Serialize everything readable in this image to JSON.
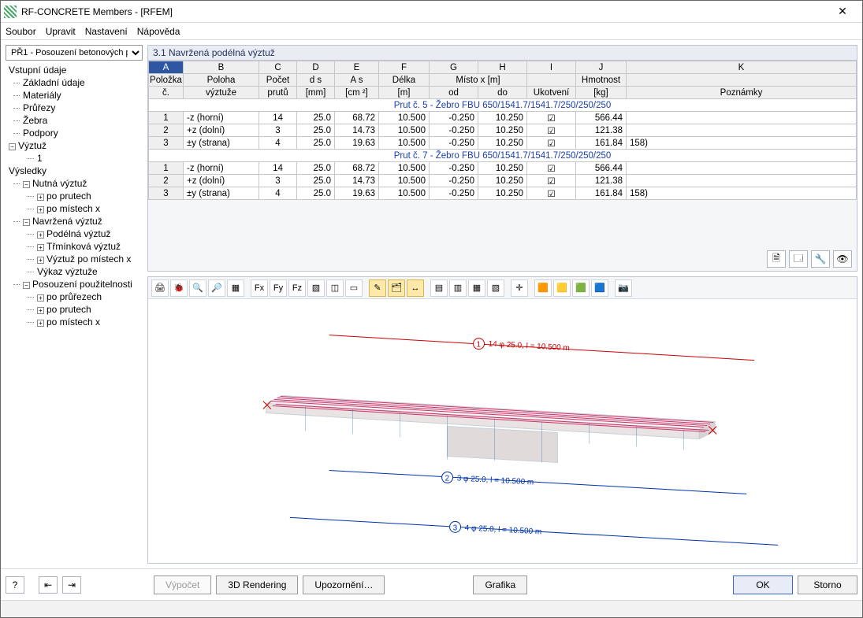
{
  "window": {
    "title": "RF-CONCRETE Members - [RFEM]"
  },
  "menu": [
    "Soubor",
    "Upravit",
    "Nastavení",
    "Nápověda"
  ],
  "case_selector": "PŘ1 - Posouzení betonových pr",
  "tree": {
    "top": "Vstupní údaje",
    "items_top": [
      "Základní údaje",
      "Materiály",
      "Průřezy",
      "Žebra",
      "Podpory"
    ],
    "reinf": "Výztuž",
    "reinf_item": "1",
    "results": "Výsledky",
    "req": "Nutná výztuž",
    "req_items": [
      "po prutech",
      "po místech x"
    ],
    "prov": "Navržená výztuž",
    "prov_items": [
      "Podélná výztuž",
      "Třmínková výztuž",
      "Výztuž po místech x",
      "Výkaz výztuže"
    ],
    "serv": "Posouzení použitelnosti",
    "serv_items": [
      "po průřezech",
      "po prutech",
      "po místech x"
    ]
  },
  "section_title": "3.1 Navržená podélná výztuž",
  "columns_letters": [
    "A",
    "B",
    "C",
    "D",
    "E",
    "F",
    "G",
    "H",
    "I",
    "J",
    "K"
  ],
  "headers1": {
    "item": "Položka",
    "poloha": "Poloha",
    "pocet": "Počet",
    "ds": "d s",
    "as": "A s",
    "delka": "Délka",
    "misto": "Místo x [m]",
    "ukot": "",
    "hm": "Hmotnost",
    "pozn": ""
  },
  "headers2": {
    "item": "č.",
    "poloha": "výztuže",
    "pocet": "prutů",
    "ds": "[mm]",
    "as": "[cm ²]",
    "delka": "[m]",
    "od": "od",
    "do": "do",
    "ukot": "Ukotvení",
    "hm": "[kg]",
    "pozn": "Poznámky"
  },
  "section_rows": [
    "Prut č. 5  -  Žebro FBU 650/1541.7/1541.7/250/250/250",
    "Prut č. 7  -  Žebro FBU 650/1541.7/1541.7/250/250/250"
  ],
  "rows": [
    {
      "n": "1",
      "pol": "-z (horní)",
      "cnt": "14",
      "ds": "25.0",
      "as": "68.72",
      "len": "10.500",
      "od": "-0.250",
      "do": "10.250",
      "anch": true,
      "hm": "566.44",
      "note": ""
    },
    {
      "n": "2",
      "pol": "+z (dolní)",
      "cnt": "3",
      "ds": "25.0",
      "as": "14.73",
      "len": "10.500",
      "od": "-0.250",
      "do": "10.250",
      "anch": true,
      "hm": "121.38",
      "note": ""
    },
    {
      "n": "3",
      "pol": "±y (strana)",
      "cnt": "4",
      "ds": "25.0",
      "as": "19.63",
      "len": "10.500",
      "od": "-0.250",
      "do": "10.250",
      "anch": true,
      "hm": "161.84",
      "note": "158)"
    }
  ],
  "render_toolbar_icons": [
    "print-icon",
    "bug-icon",
    "zoom-icon",
    "search-icon",
    "grid-icon",
    "axis-x-icon",
    "axis-y-icon",
    "axis-z-icon",
    "box-icon",
    "cube-icon",
    "rect-icon",
    "pen-icon",
    "layer-icon",
    "swap-icon",
    "layout1-icon",
    "layout2-icon",
    "layout3-icon",
    "layout4-icon",
    "axes-icon",
    "color1-icon",
    "color2-icon",
    "color3-icon",
    "color4-icon",
    "photo-icon"
  ],
  "render_labels": {
    "l1": "14 φ 25.0, l = 10.500 m",
    "l2": "3 φ 25.0, l = 10.500 m",
    "l3": "4 φ 25.0, l = 10.500 m",
    "n1": "1",
    "n2": "2",
    "n3": "3"
  },
  "panel_btns": [
    "excel-icon",
    "table-icon",
    "filter-icon",
    "eye-icon"
  ],
  "bottom": {
    "calc": "Výpočet",
    "render": "3D Rendering",
    "warn": "Upozornění…",
    "graph": "Grafika",
    "ok": "OK",
    "cancel": "Storno"
  }
}
